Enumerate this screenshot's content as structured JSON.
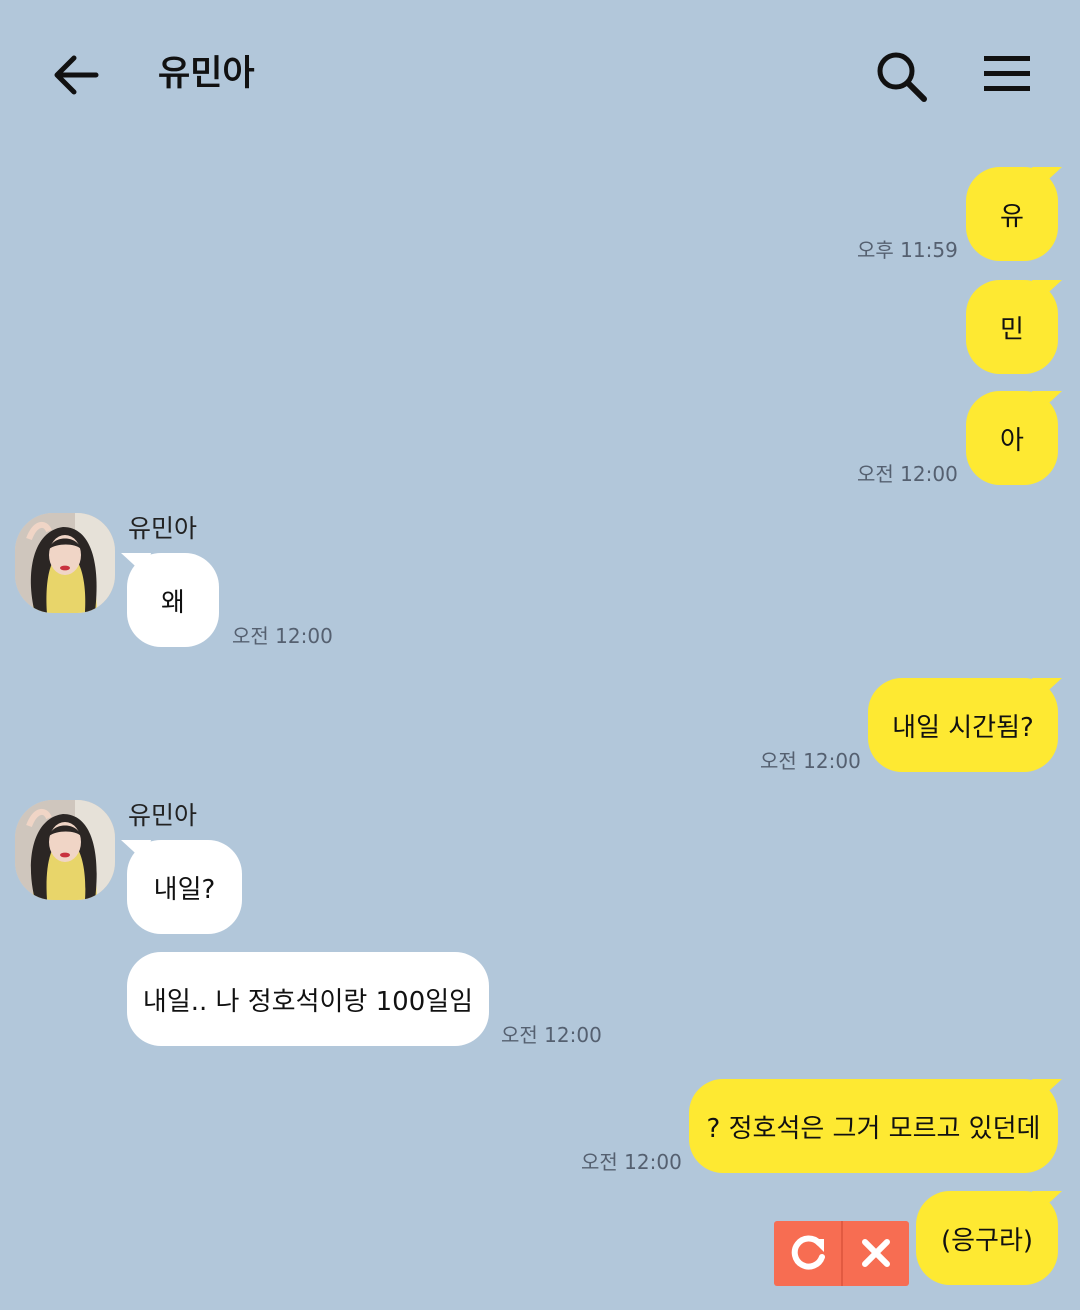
{
  "header": {
    "title": "유민아",
    "back_icon": "arrow-left-icon",
    "search_icon": "search-icon",
    "menu_icon": "hamburger-menu-icon"
  },
  "colors": {
    "background": "#b2c7da",
    "my_bubble": "#fee932",
    "their_bubble": "#ffffff",
    "fail_control": "#f76d52"
  },
  "messages": {
    "m1": {
      "text": "유"
    },
    "t1": {
      "text": "오후 11:59"
    },
    "m2": {
      "text": "민"
    },
    "m3": {
      "text": "아"
    },
    "t3": {
      "text": "오전 12:00"
    },
    "sender1": {
      "name": "유민아"
    },
    "r1": {
      "text": "왜"
    },
    "tr1": {
      "text": "오전 12:00"
    },
    "m4": {
      "text": "내일 시간됨?"
    },
    "t4": {
      "text": "오전 12:00"
    },
    "sender2": {
      "name": "유민아"
    },
    "r2": {
      "text": "내일?"
    },
    "r3": {
      "text": "내일.. 나 정호석이랑 100일임"
    },
    "tr3": {
      "text": "오전 12:00"
    },
    "m5": {
      "text": "? 정호석은 그거 모르고 있던데"
    },
    "t5": {
      "text": "오전 12:00"
    },
    "m6": {
      "text": "(응구라)"
    }
  },
  "failed_send": {
    "retry_icon": "retry-icon",
    "cancel_icon": "close-icon"
  }
}
